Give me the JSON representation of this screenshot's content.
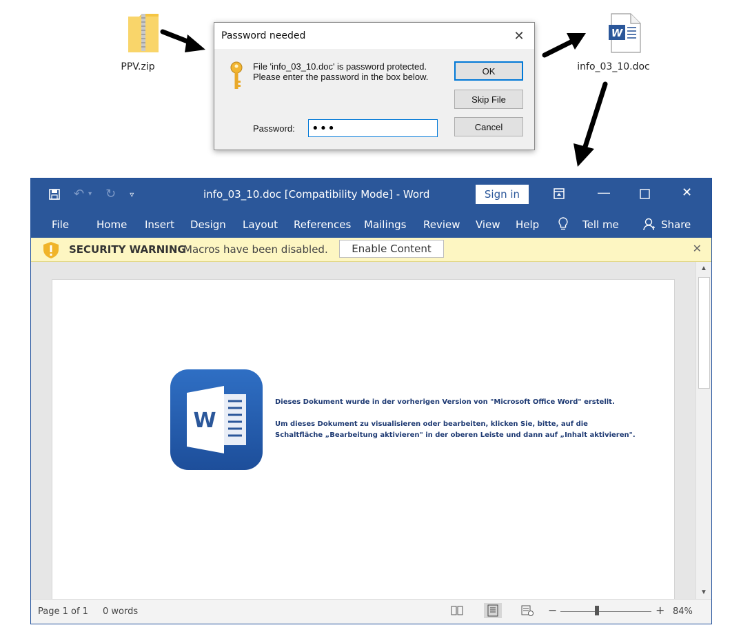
{
  "files": {
    "zip_name": "PPV.zip",
    "doc_name": "info_03_10.doc",
    "doc_icon_letter": "W",
    "zip_icon": "zip-folder-icon",
    "doc_icon": "word-doc-icon"
  },
  "dialog": {
    "title": "Password needed",
    "message": "File 'info_03_10.doc' is password protected.  Please enter the password in the box below.",
    "password_label": "Password:",
    "password_value": "•••",
    "ok_label": "OK",
    "skip_label": "Skip File",
    "cancel_label": "Cancel",
    "close_glyph": "✕"
  },
  "word": {
    "title": "info_03_10.doc [Compatibility Mode]  -  Word",
    "sign_in": "Sign in",
    "tabs": [
      "File",
      "Home",
      "Insert",
      "Design",
      "Layout",
      "References",
      "Mailings",
      "Review",
      "View",
      "Help",
      "Tell me",
      "Share"
    ],
    "security": {
      "heading": "SECURITY WARNING",
      "text": "Macros have been disabled.",
      "button": "Enable Content"
    },
    "document": {
      "logo_letter": "W",
      "line1": "Dieses Dokument wurde in der vorherigen Version von \"Microsoft Office Word\" erstellt.",
      "line2": "Um dieses Dokument zu visualisieren oder bearbeiten, klicken Sie, bitte, auf die",
      "line3": "Schaltfläche „Bearbeitung aktivieren\" in der oberen Leiste und dann auf „Inhalt aktivieren\"."
    },
    "status": {
      "page": "Page 1 of 1",
      "words": "0 words",
      "zoom": "84%",
      "zoom_level": 0.84
    }
  },
  "colors": {
    "word_blue": "#2b579a",
    "warning_bg": "#fdf6c2",
    "dialog_bg": "#f0f0f0",
    "focus_blue": "#0078d7"
  }
}
